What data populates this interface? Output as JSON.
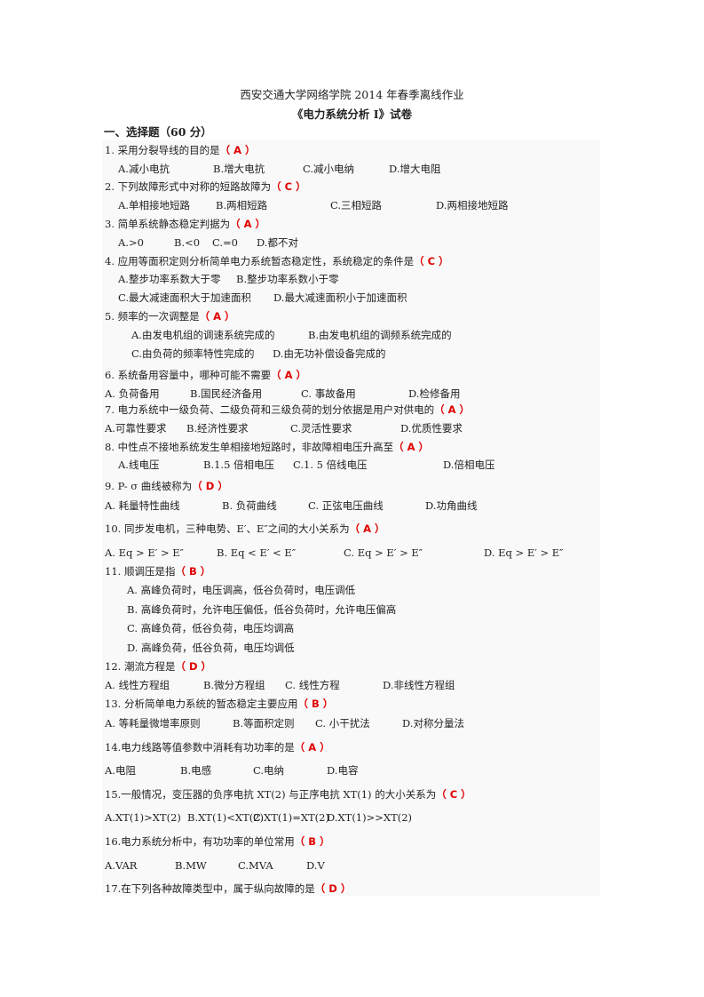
{
  "header": {
    "title": "西安交通大学网络学院 2014 年春季离线作业",
    "subtitle": "《电力系统分析 I》试卷",
    "section": "一、选择题（60 分）"
  },
  "questions": [
    {
      "q": "1. 采用分裂导线的目的是",
      "answer": "（  A  ）",
      "options": [
        "A.减小电抗",
        "B.增大电抗",
        "C.减小电纳",
        "D.增大电阻"
      ]
    },
    {
      "q": "2. 下列故障形式中对称的短路故障为",
      "answer": "（  C  ）",
      "options": [
        "A.单相接地短路",
        "B.两相短路",
        "C.三相短路",
        "D.两相接地短路"
      ]
    },
    {
      "q": "3. 简单系统静态稳定判据为",
      "answer": "（  A  ）",
      "options": [
        "A.>0",
        "B.<0",
        "C.=0",
        "D.都不对"
      ]
    },
    {
      "q": "4. 应用等面积定则分析简单电力系统暂态稳定性，系统稳定的条件是",
      "answer": "（  C    ）",
      "options": [
        "A.整步功率系数大于零",
        "B.整步功率系数小于零",
        "C.最大减速面积大于加速面积",
        "D.最大减速面积小于加速面积"
      ]
    },
    {
      "q": "5. 频率的一次调整是",
      "answer": "（  A  ）",
      "options": [
        "A.由发电机组的调速系统完成的",
        "B.由发电机组的调频系统完成的",
        "C.由负荷的频率特性完成的",
        "D.由无功补偿设备完成的"
      ]
    },
    {
      "q": "6. 系统备用容量中，哪种可能不需要",
      "answer": "（   A   ）",
      "options": [
        "A. 负荷备用",
        "B.国民经济备用",
        "C. 事故备用",
        "D.检修备用"
      ]
    },
    {
      "q": "7. 电力系统中一级负荷、二级负荷和三级负荷的划分依据是用户对供电的",
      "answer": "（  A  ）",
      "options": [
        "A.可靠性要求",
        "B.经济性要求",
        "C.灵活性要求",
        "D.优质性要求"
      ]
    },
    {
      "q": "8. 中性点不接地系统发生单相接地短路时，非故障相电压升高至",
      "answer": "（  A    ）",
      "options": [
        "A.线电压",
        "B.1.5 倍相电压",
        "C.1. 5 倍线电压",
        "D.倍相电压"
      ]
    },
    {
      "q": "9. P- σ 曲线被称为",
      "answer": "（    D    ）",
      "options": [
        "A. 耗量特性曲线",
        "B. 负荷曲线",
        "C. 正弦电压曲线",
        "D.功角曲线"
      ]
    },
    {
      "q": "10. 同步发电机，三种电势、E′、E″之间的大小关系为",
      "answer": "（    A  ）",
      "options": [
        "A. Eq >  E′ >  E″",
        "B. Eq <  E′ <  E″",
        "C. Eq >  E′ >  E″",
        "D. Eq >  E′ >  E″"
      ]
    },
    {
      "q": "11. 顺调压是指",
      "answer": "（      B        ）",
      "options": [
        "A. 高峰负荷时，电压调高，低谷负荷时，电压调低",
        "B. 高峰负荷时，允许电压偏低，低谷负荷时，允许电压偏高",
        "C. 高峰负荷，低谷负荷，电压均调高",
        "D. 高峰负荷，低谷负荷，电压均调低"
      ]
    },
    {
      "q": "12. 潮流方程是",
      "answer": "（      D            ）",
      "options": [
        "A. 线性方程组",
        "B.微分方程组",
        "C. 线性方程",
        "D.非线性方程组"
      ]
    },
    {
      "q": "13. 分析简单电力系统的暂态稳定主要应用",
      "answer": "（       B          ）",
      "options": [
        "A. 等耗量微增率原则",
        "B.等面积定则",
        "C. 小干扰法",
        "D.对称分量法"
      ]
    },
    {
      "q": "14.电力线路等值参数中消耗有功功率的是",
      "answer": "（  A  ）",
      "options": [
        "A.电阻",
        "B.电感",
        "C.电纳",
        "D.电容"
      ]
    },
    {
      "q": "15.一般情况，变压器的负序电抗 XT(2) 与正序电抗 XT(1) 的大小关系为",
      "answer": "（  C  ）",
      "options": [
        "A.XT(1)>XT(2)",
        "B.XT(1)<XT(2)",
        "C.XT(1)=XT(2)",
        "D.XT(1)>>XT(2)"
      ]
    },
    {
      "q": "16.电力系统分析中，有功功率的单位常用",
      "answer": "（  B  ）",
      "options": [
        "A.VAR",
        "B.MW",
        "C.MVA",
        "D.V"
      ]
    },
    {
      "q": "17.在下列各种故障类型中，属于纵向故障的是",
      "answer": "（  D  ）",
      "options": []
    }
  ]
}
